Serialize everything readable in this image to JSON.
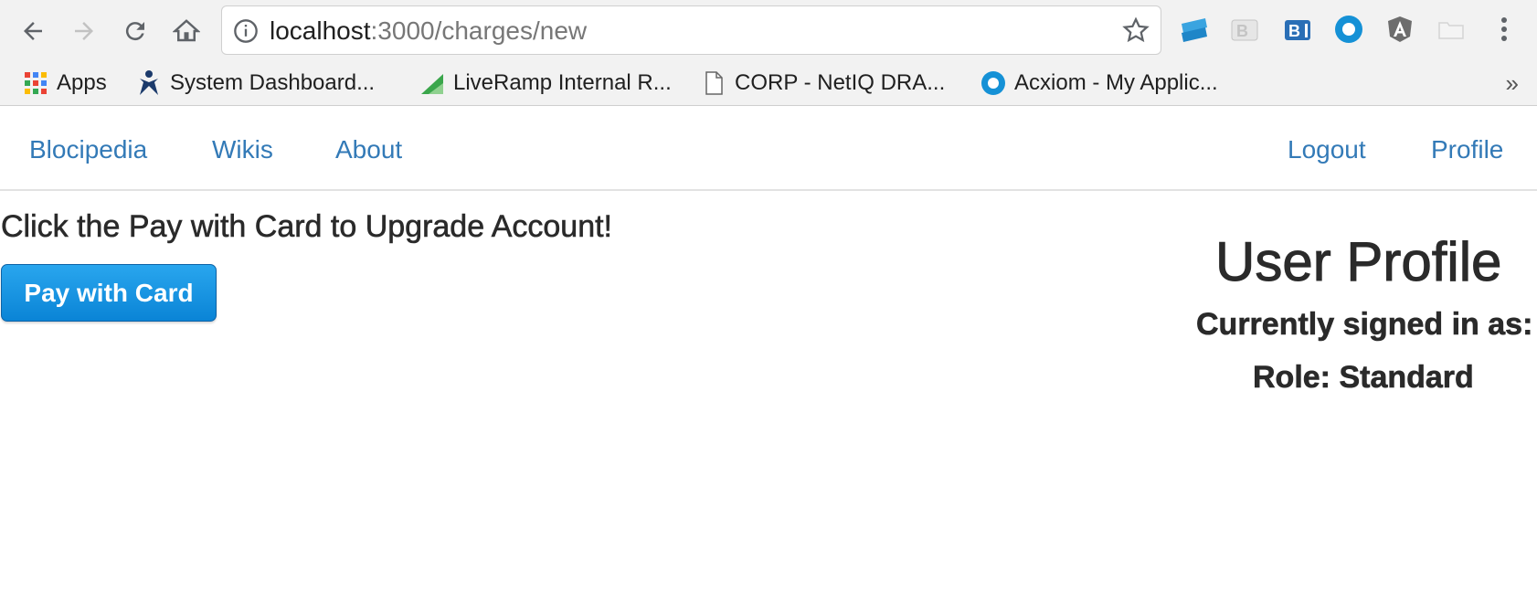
{
  "browser": {
    "url_host": "localhost",
    "url_path": ":3000/charges/new",
    "extensions": [
      "stackblitz-icon",
      "bootstrap-gray-icon",
      "bootstrap-blue-icon",
      "circle-blue-icon",
      "angular-icon",
      "folder-icon",
      "menu-dots-icon"
    ]
  },
  "bookmarks": [
    {
      "label": "Apps",
      "icon": "apps-grid-icon"
    },
    {
      "label": "System Dashboard...",
      "icon": "jira-icon"
    },
    {
      "label": "LiveRamp Internal R...",
      "icon": "liveramp-icon"
    },
    {
      "label": "CORP - NetIQ DRA...",
      "icon": "page-icon"
    },
    {
      "label": "Acxiom - My Applic...",
      "icon": "circle-blue-icon"
    }
  ],
  "bookmarks_more": "»",
  "nav": {
    "brand": "Blocipedia",
    "wikis": "Wikis",
    "about": "About",
    "logout": "Logout",
    "profile": "Profile"
  },
  "main": {
    "heading": "Click the Pay with Card to Upgrade Account!",
    "pay_button": "Pay with Card"
  },
  "profile": {
    "title": "User Profile",
    "signed_in": "Currently signed in as:",
    "role": "Role: Standard"
  },
  "colors": {
    "link": "#337ab7",
    "pay_button": "#0a84d6"
  }
}
